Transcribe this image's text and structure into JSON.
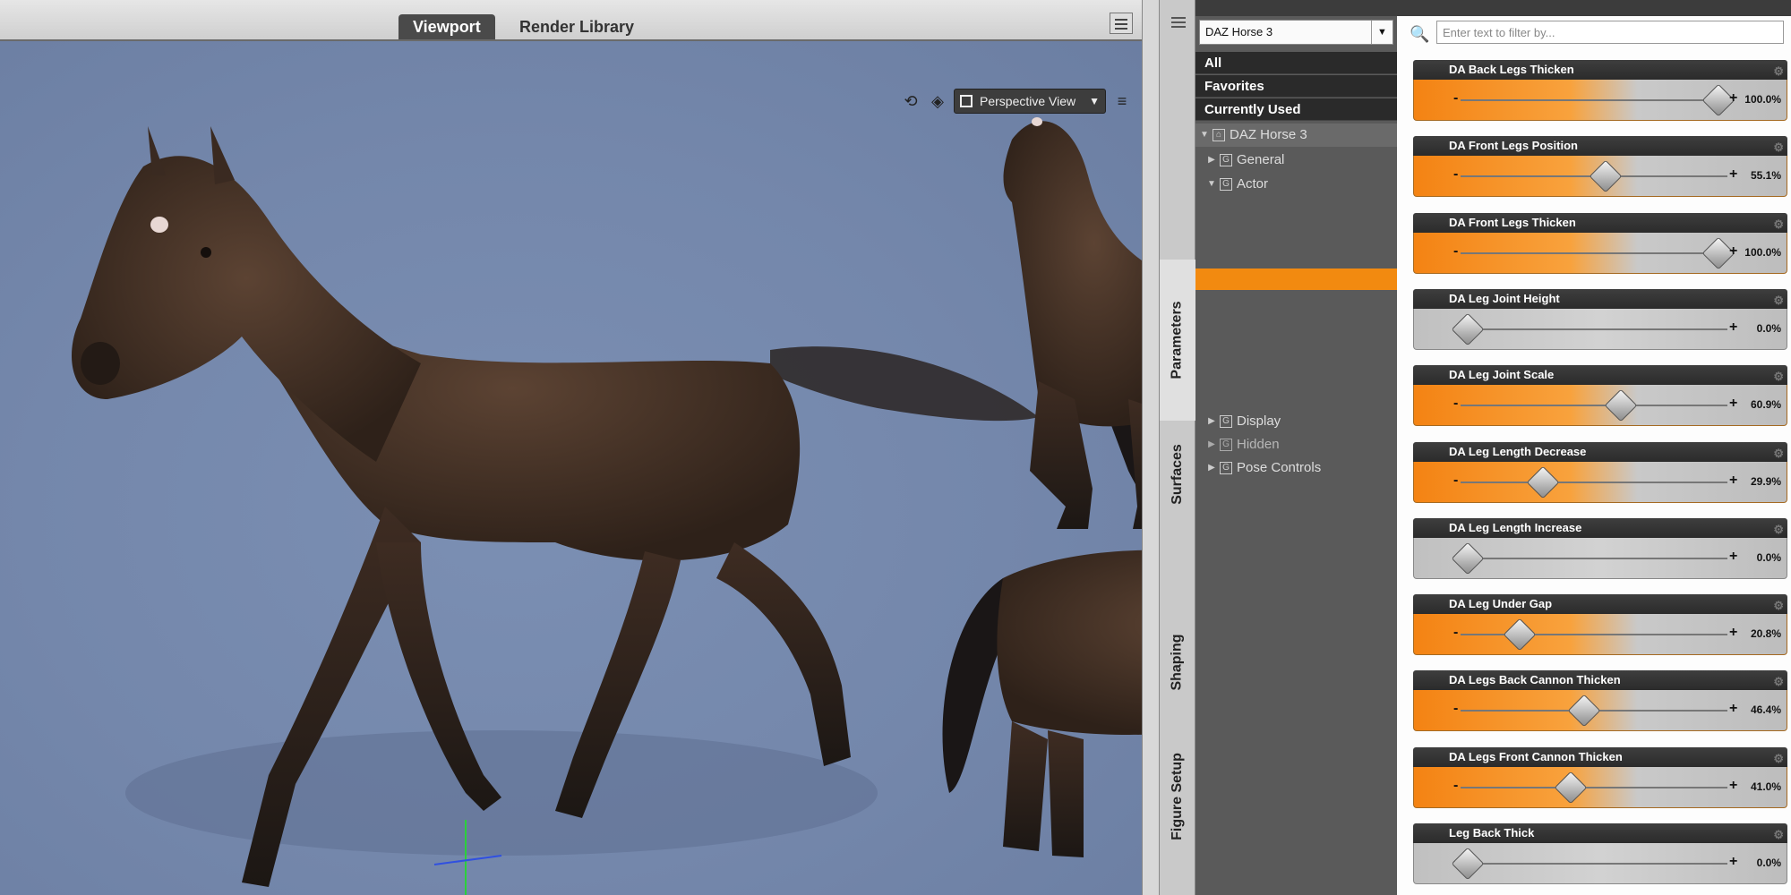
{
  "viewport": {
    "tabs": [
      {
        "label": "Viewport",
        "active": true
      },
      {
        "label": "Render Library",
        "active": false
      }
    ],
    "camera": "Perspective View",
    "toolbar_icons": [
      "rotate-icon",
      "render-mode-icon",
      "grid-icon",
      "menu-icon"
    ]
  },
  "side_tabs": {
    "parameters": "Parameters",
    "surfaces": "Surfaces",
    "shaping": "Shaping",
    "figure_setup": "Figure Setup"
  },
  "tree": {
    "figure_select": "DAZ Horse 3",
    "categories": [
      "All",
      "Favorites",
      "Currently Used"
    ],
    "root": "DAZ Horse 3",
    "nodes": {
      "general": "General",
      "actor": "Actor",
      "display": "Display",
      "hidden": "Hidden",
      "pose_controls": "Pose Controls"
    }
  },
  "filter": {
    "placeholder": "Enter text to filter by..."
  },
  "sliders": [
    {
      "label": "DA Back Legs Thicken",
      "value": 100.0,
      "display": "100.0%"
    },
    {
      "label": "DA Front Legs Position",
      "value": 55.1,
      "display": "55.1%"
    },
    {
      "label": "DA Front Legs Thicken",
      "value": 100.0,
      "display": "100.0%"
    },
    {
      "label": "DA Leg Joint Height",
      "value": 0.0,
      "display": "0.0%"
    },
    {
      "label": "DA Leg Joint Scale",
      "value": 60.9,
      "display": "60.9%"
    },
    {
      "label": "DA Leg Length Decrease",
      "value": 29.9,
      "display": "29.9%"
    },
    {
      "label": "DA Leg Length Increase",
      "value": 0.0,
      "display": "0.0%"
    },
    {
      "label": "DA Leg Under Gap",
      "value": 20.8,
      "display": "20.8%"
    },
    {
      "label": "DA Legs Back Cannon Thicken",
      "value": 46.4,
      "display": "46.4%"
    },
    {
      "label": "DA Legs Front Cannon Thicken",
      "value": 41.0,
      "display": "41.0%"
    },
    {
      "label": "Leg Back Thick",
      "value": 0.0,
      "display": "0.0%"
    }
  ],
  "colors": {
    "accent": "#f48313",
    "scene_bg": "#7487ab",
    "horse_body": "#4a3426"
  }
}
